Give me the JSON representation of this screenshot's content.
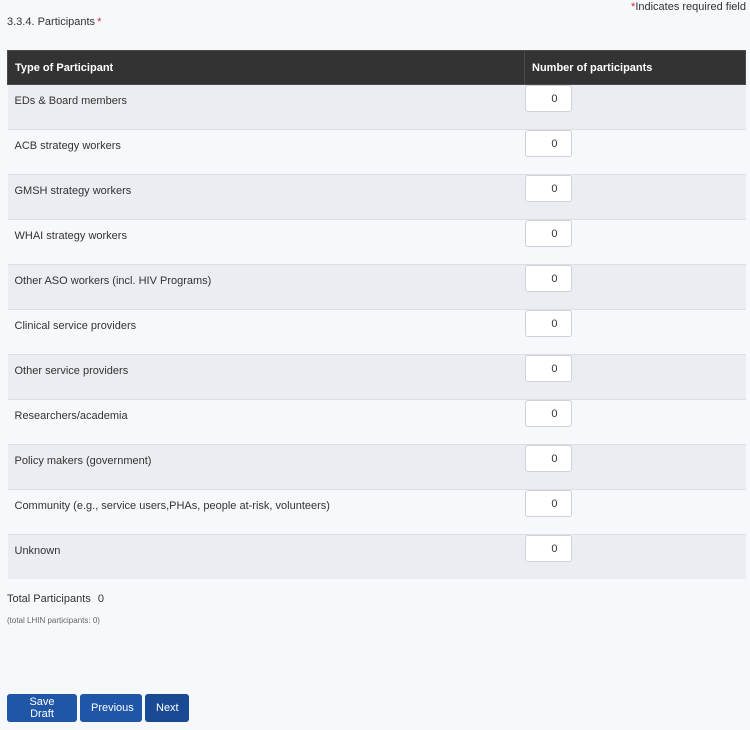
{
  "required_note": {
    "star": "*",
    "text": "Indicates required field"
  },
  "section": {
    "label": "3.3.4. Participants",
    "required_star": "*"
  },
  "table": {
    "headers": {
      "type": "Type of Participant",
      "number": "Number of participants"
    },
    "rows": [
      {
        "type": "EDs & Board members",
        "value": "0"
      },
      {
        "type": "ACB strategy workers",
        "value": "0"
      },
      {
        "type": "GMSH strategy workers",
        "value": "0"
      },
      {
        "type": "WHAI strategy workers",
        "value": "0"
      },
      {
        "type": "Other ASO workers (incl. HIV Programs)",
        "value": "0"
      },
      {
        "type": "Clinical service providers",
        "value": "0"
      },
      {
        "type": "Other service providers",
        "value": "0"
      },
      {
        "type": "Researchers/academia",
        "value": "0"
      },
      {
        "type": "Policy makers (government)",
        "value": "0"
      },
      {
        "type": "Community (e.g., service users,PHAs, people at-risk, volunteers)",
        "value": "0"
      },
      {
        "type": "Unknown",
        "value": "0"
      }
    ]
  },
  "total": {
    "label": "Total Participants",
    "value": "0"
  },
  "lhin_note": "(total LHIN participants: 0)",
  "buttons": {
    "save_draft": "Save Draft",
    "previous": "Previous",
    "next": "Next"
  },
  "colors": {
    "header_bg": "#333333",
    "button_bg": "#1f56a8",
    "required_star": "#d9262e"
  }
}
